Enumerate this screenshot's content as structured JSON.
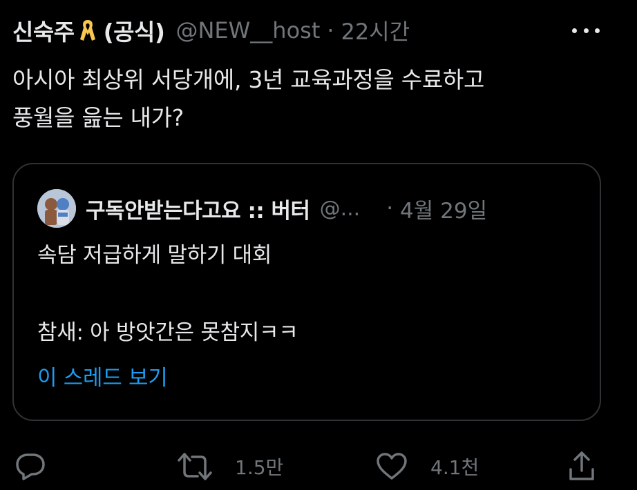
{
  "tweet": {
    "display_name": "신숙주",
    "badge_icon": "yellow-ribbon-icon",
    "org_label": "(공식)",
    "handle": "@NEW__host",
    "separator": "·",
    "time": "22시간",
    "text_lines": [
      "아시아 최상위 서당개에, 3년 교육과정을 수료하고",
      "풍월을 읊는 내가?"
    ]
  },
  "quote": {
    "display_name": "구독안받는다고요 :: 버터",
    "handle": "@...",
    "separator": "·",
    "time": "4월 29일",
    "text_lines": [
      "속담 저급하게 말하기 대회",
      "",
      "참새: 아 방앗간은 못참지ㅋㅋ"
    ],
    "thread_link": "이 스레드 보기"
  },
  "actions": {
    "reply_icon": "reply-icon",
    "retweet_icon": "retweet-icon",
    "retweet_count": "1.5만",
    "like_icon": "heart-icon",
    "like_count": "4.1천",
    "share_icon": "share-icon"
  },
  "colors": {
    "background": "#000000",
    "text": "#e7e9ea",
    "muted": "#71767b",
    "link": "#1d9bf0",
    "ribbon": "#f9c74f",
    "border": "#2f3336"
  }
}
